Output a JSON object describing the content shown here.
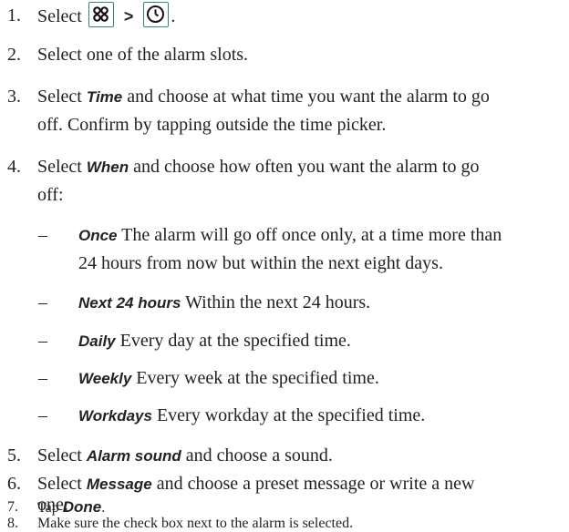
{
  "steps": [
    {
      "num": "1.",
      "prefix": "Select",
      "icons": [
        "menu-grid-icon",
        "clock-icon"
      ],
      "separator": ">",
      "suffix": "."
    },
    {
      "num": "2.",
      "text": "Select one of the alarm slots."
    },
    {
      "num": "3.",
      "line1_pre": "Select",
      "ui": "Time",
      "line1_post": "and choose at what time you want the alarm to go",
      "line2": "off. Confirm by tapping outside the time picker."
    },
    {
      "num": "4.",
      "line1_pre": "Select",
      "ui": "When",
      "line1_post": "and choose how often you want the alarm to go",
      "line2": "off:"
    },
    {
      "num": "5.",
      "pre": "Select",
      "ui": "Alarm sound",
      "post": "and choose a sound."
    },
    {
      "num": "6.",
      "line1_pre": "Select",
      "ui": "Message",
      "line1_post": "and choose a preset message or write a new",
      "line2": "one."
    },
    {
      "num": "7.",
      "pre": "Tap",
      "ui": "Done",
      "post": "."
    },
    {
      "num": "8.",
      "text": "Make sure the check box next to the alarm is selected."
    }
  ],
  "options": [
    {
      "dash": "–",
      "ui": "Once",
      "line1": "The alarm will go off once only, at a time more than",
      "line2": "24 hours from now but within the next eight days."
    },
    {
      "dash": "–",
      "ui": "Next 24 hours",
      "line1": "Within the next 24 hours."
    },
    {
      "dash": "–",
      "ui": "Daily",
      "line1": "Every day at the specified time."
    },
    {
      "dash": "–",
      "ui": "Weekly",
      "line1": "Every week at the specified time."
    },
    {
      "dash": "–",
      "ui": "Workdays",
      "line1": "Every workday at the specified time."
    }
  ],
  "colors": {
    "text": "#222222",
    "icon_border": "#2b8a7a"
  }
}
